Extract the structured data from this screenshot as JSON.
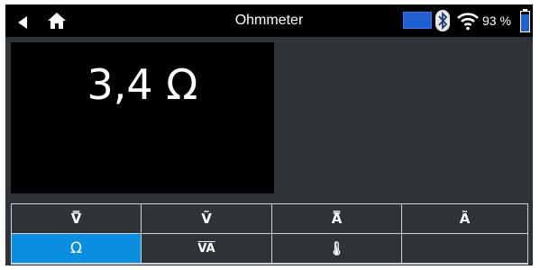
{
  "header": {
    "title": "Ohmmeter",
    "battery_percent": "93 %",
    "icons": [
      "back-arrow-icon",
      "home-icon",
      "screen-icon",
      "bluetooth-icon",
      "wifi-icon",
      "battery-icon"
    ]
  },
  "display": {
    "reading": "3,4 Ω"
  },
  "modes": [
    {
      "label": "V̿",
      "name": "dc-voltage"
    },
    {
      "label": "Ṽ",
      "name": "ac-voltage"
    },
    {
      "label": "A̿",
      "name": "dc-current"
    },
    {
      "label": "Ã",
      "name": "ac-current"
    },
    {
      "label": "Ω",
      "name": "resistance",
      "active": true
    },
    {
      "label": "VA",
      "name": "power"
    },
    {
      "label": "🌡",
      "name": "temperature"
    },
    {
      "label": "",
      "name": "empty"
    }
  ],
  "colors": {
    "statusbar": "#000000",
    "panel": "#2e3338",
    "active_mode": "#0a8fe0",
    "display": "#000000"
  }
}
